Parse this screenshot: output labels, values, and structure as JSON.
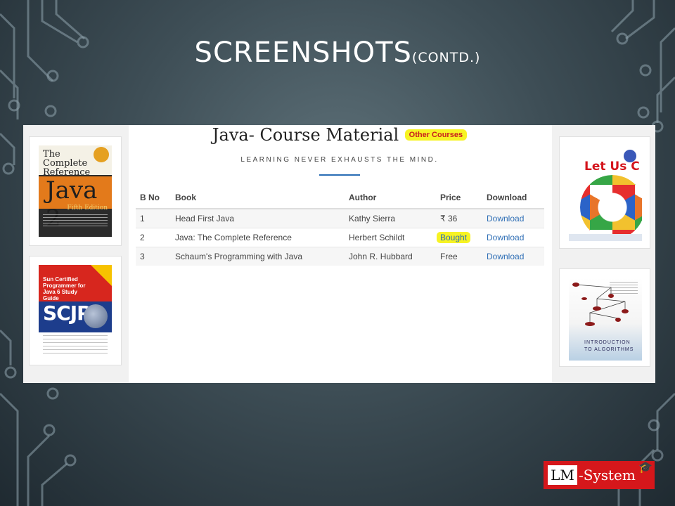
{
  "slide": {
    "title": "SCREENSHOTS",
    "title_suffix": "(CONTD.)"
  },
  "course_page": {
    "heading": "Java- Course Material",
    "other_courses_link": "Other Courses",
    "tagline": "LEARNING NEVER EXHAUSTS THE MIND.",
    "highlight_color": "#f7f323",
    "link_color": "#2e6eb5",
    "table": {
      "headers": [
        "B No",
        "Book",
        "Author",
        "Price",
        "Download"
      ],
      "rows": [
        {
          "no": "1",
          "book": "Head First Java",
          "author": "Kathy Sierra",
          "price": "₹ 36",
          "download": "Download"
        },
        {
          "no": "2",
          "book": "Java: The Complete Reference",
          "author": "Herbert Schildt",
          "price": "Bought",
          "download": "Download"
        },
        {
          "no": "3",
          "book": "Schaum's Programming with Java",
          "author": "John R. Hubbard",
          "price": "Free",
          "download": "Download"
        }
      ]
    }
  },
  "book_covers": {
    "java2": {
      "title_top": "The Complete Reference",
      "title_main": "Java 2",
      "edition": "Fifth Edition"
    },
    "scjp": {
      "title_top": "Sun Certified Programmer for Java 6 Study Guide",
      "title_main": "SCJP"
    },
    "letusc": {
      "title": "Let Us C"
    },
    "algorithms": {
      "title": "INTRODUCTION TO ALGORITHMS"
    }
  },
  "brand": {
    "lm": "LM",
    "system": "-System",
    "color": "#d5171b"
  }
}
